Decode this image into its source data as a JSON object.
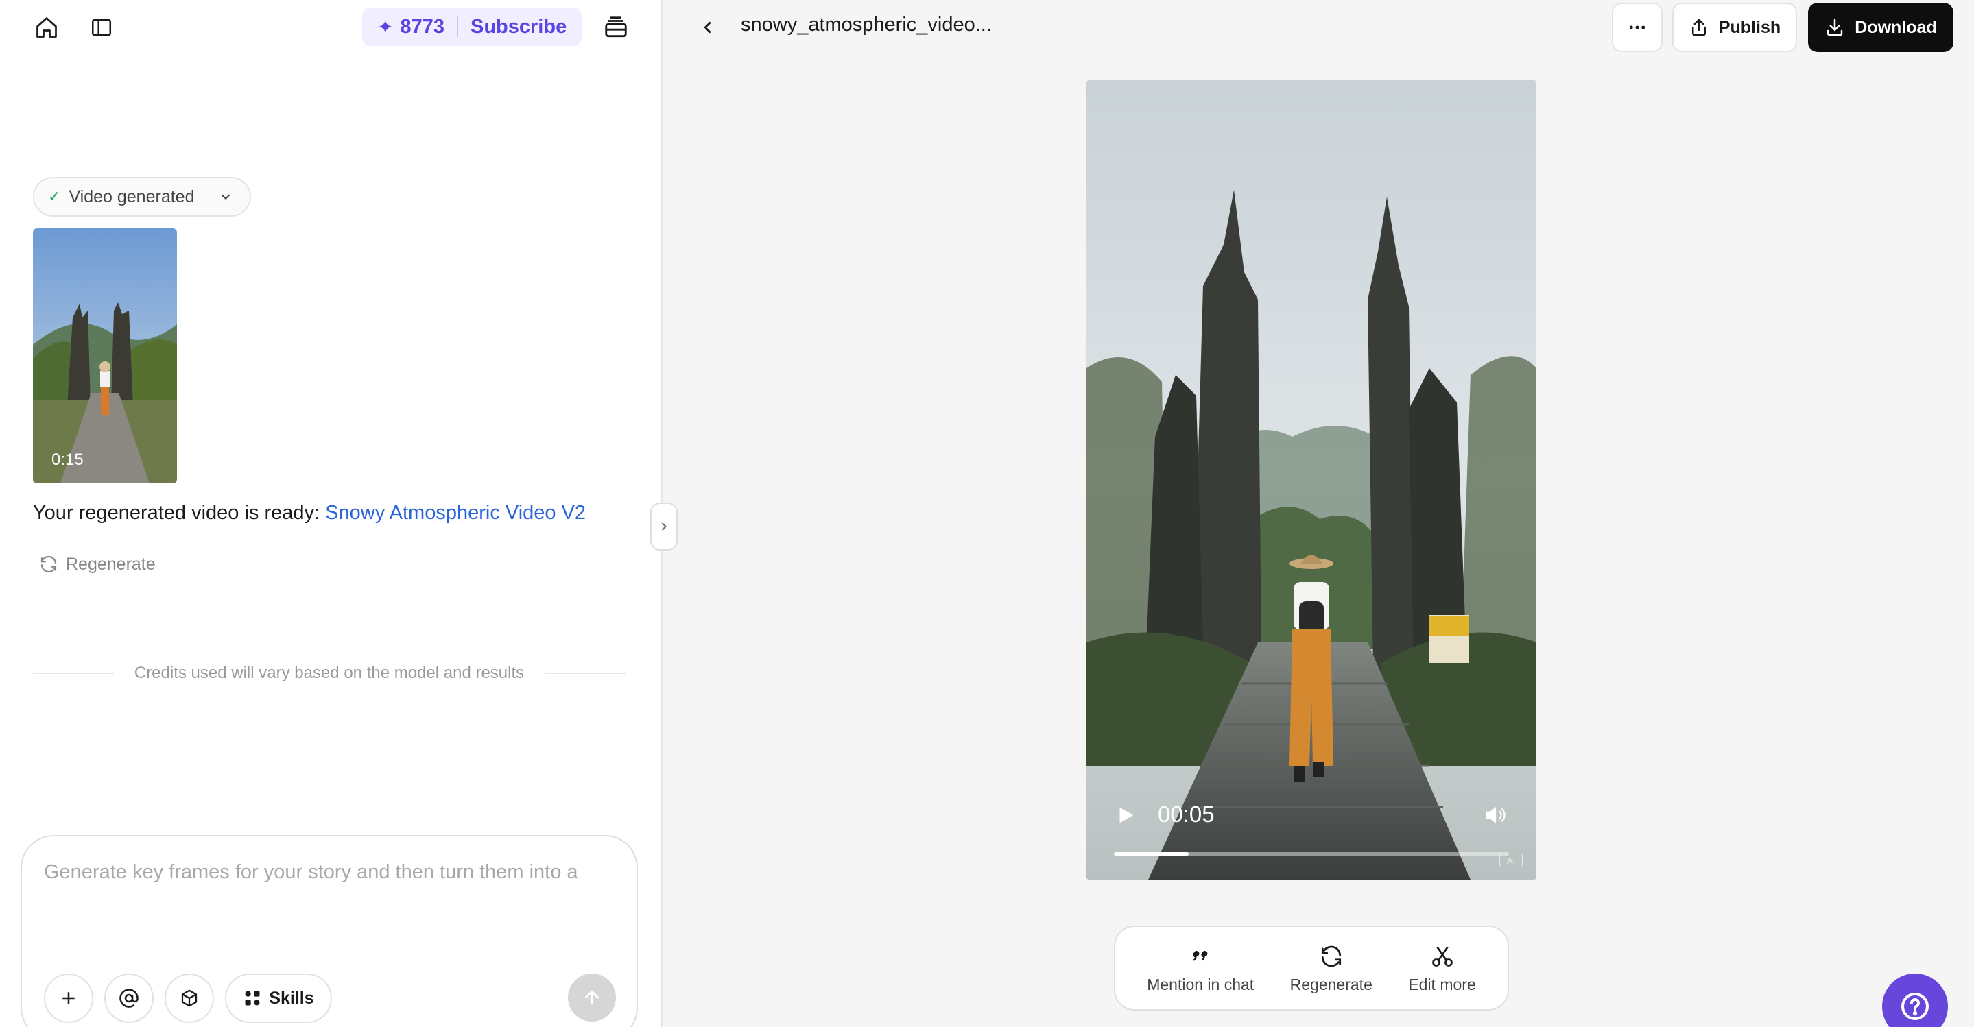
{
  "header_left": {
    "home_icon": "home-icon",
    "sidebar_icon": "sidebar-icon",
    "credits": "8773",
    "subscribe_label": "Subscribe",
    "history_icon": "stack-icon"
  },
  "chat": {
    "status_label": "Video generated",
    "thumbnail_duration": "0:15",
    "ready_text": "Your regenerated video is ready: ",
    "ready_link": "Snowy Atmospheric Video V2",
    "regenerate_label": "Regenerate",
    "credits_note": "Credits used will vary based on the model and results"
  },
  "composer": {
    "placeholder": "Generate key frames for your story and then turn them into a",
    "value": "",
    "skills_label": "Skills"
  },
  "viewer": {
    "title": "snowy_atmospheric_video...",
    "publish_label": "Publish",
    "download_label": "Download",
    "current_time": "00:05",
    "progress": 0.19,
    "ai_badge": "AI"
  },
  "actions": [
    {
      "label": "Mention in chat",
      "icon": "quote-icon"
    },
    {
      "label": "Regenerate",
      "icon": "refresh-icon"
    },
    {
      "label": "Edit more",
      "icon": "scissors-icon"
    }
  ],
  "colors": {
    "accent": "#5b45e0",
    "link": "#2b63d9",
    "download_bg": "#0e0e0e",
    "help_bg": "#6646db"
  }
}
